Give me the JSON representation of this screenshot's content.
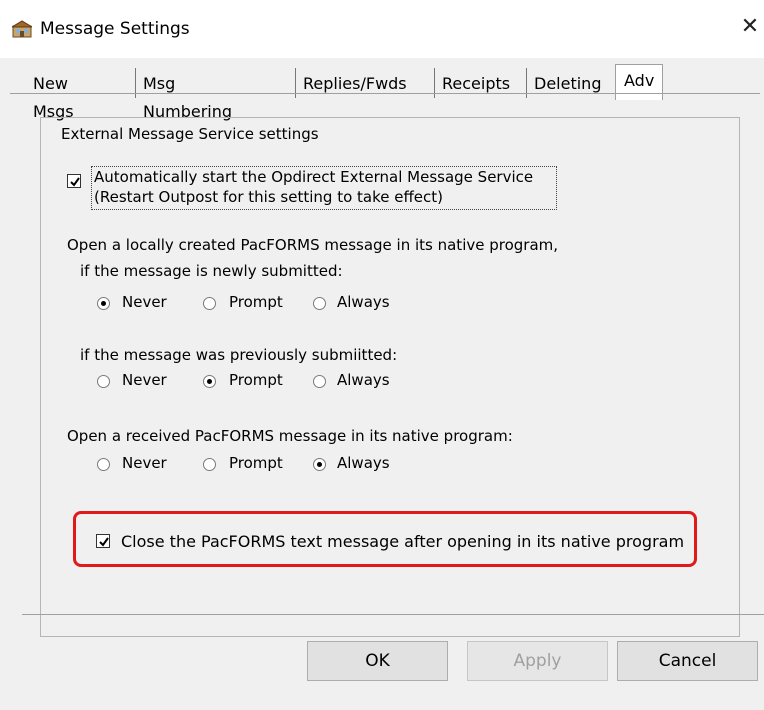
{
  "window": {
    "title": "Message Settings",
    "close_glyph": "✕"
  },
  "tabs": [
    {
      "label": "New Msgs",
      "active": false
    },
    {
      "label": "Msg Numbering",
      "active": false
    },
    {
      "label": "Replies/Fwds",
      "active": false
    },
    {
      "label": "Receipts",
      "active": false
    },
    {
      "label": "Deleting",
      "active": false
    },
    {
      "label": "Adv",
      "active": true
    }
  ],
  "group": {
    "title": "External Message Service settings",
    "auto_start": {
      "checked": true,
      "line1": "Automatically start the Opdirect External Message Service",
      "line2": "(Restart Outpost for this setting to take effect)"
    },
    "local_heading": "Open a locally created PacFORMS message in its native program,",
    "newly_heading": "if the message is newly submitted:",
    "newly_options": {
      "never": "Never",
      "prompt": "Prompt",
      "always": "Always",
      "selected": "Never"
    },
    "prev_heading": "if the message was previously submiitted:",
    "prev_options": {
      "never": "Never",
      "prompt": "Prompt",
      "always": "Always",
      "selected": "Prompt"
    },
    "received_heading": "Open a received PacFORMS message in its native program:",
    "received_options": {
      "never": "Never",
      "prompt": "Prompt",
      "always": "Always",
      "selected": "Always"
    },
    "close_text": {
      "checked": true,
      "label": "Close the PacFORMS text message after opening in its native program"
    }
  },
  "buttons": {
    "ok": "OK",
    "apply": "Apply",
    "cancel": "Cancel"
  },
  "colors": {
    "highlight": "#e01a1a",
    "dialog_bg": "#f0f0f0"
  }
}
